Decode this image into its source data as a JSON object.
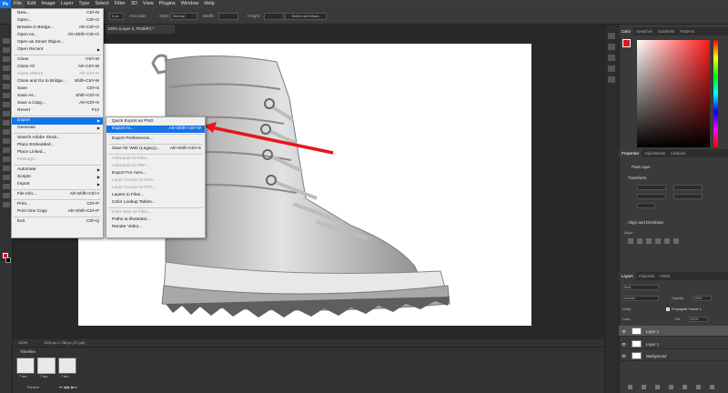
{
  "menubar": {
    "logo": "Ps",
    "items": [
      "File",
      "Edit",
      "Image",
      "Layer",
      "Type",
      "Select",
      "Filter",
      "3D",
      "View",
      "Plugins",
      "Window",
      "Help"
    ]
  },
  "options_bar": {
    "style_label": "Style:",
    "style_value": "Normal",
    "width_label": "Width:",
    "height_label": "Height:",
    "select_mask_button": "Select and Mask...",
    "feather_value": "0 px",
    "antialias_label": "Anti-alias"
  },
  "document": {
    "tab_title": "100% (Layer 2, RGB/8*) *",
    "zoom": "100%",
    "doc_info": "1200 px x 738 px (72 ppi)"
  },
  "file_menu": {
    "items": [
      {
        "label": "New...",
        "shortcut": "Ctrl+N",
        "disabled": false
      },
      {
        "label": "Open...",
        "shortcut": "Ctrl+O",
        "disabled": false
      },
      {
        "label": "Browse in Bridge...",
        "shortcut": "Alt+Ctrl+O",
        "disabled": false
      },
      {
        "label": "Open As...",
        "shortcut": "Alt+Shift+Ctrl+O",
        "disabled": false
      },
      {
        "label": "Open as Smart Object...",
        "shortcut": "",
        "disabled": false
      },
      {
        "label": "Open Recent",
        "shortcut": "",
        "disabled": false,
        "submenu": true
      },
      {
        "sep": true
      },
      {
        "label": "Close",
        "shortcut": "Ctrl+W",
        "disabled": false
      },
      {
        "label": "Close All",
        "shortcut": "Alt+Ctrl+W",
        "disabled": false
      },
      {
        "label": "Close Others",
        "shortcut": "Alt+Ctrl+P",
        "disabled": true
      },
      {
        "label": "Close and Go to Bridge...",
        "shortcut": "Shift+Ctrl+W",
        "disabled": false
      },
      {
        "label": "Save",
        "shortcut": "Ctrl+S",
        "disabled": false
      },
      {
        "label": "Save As...",
        "shortcut": "Shift+Ctrl+S",
        "disabled": false
      },
      {
        "label": "Save a Copy...",
        "shortcut": "Alt+Ctrl+S",
        "disabled": false
      },
      {
        "label": "Revert",
        "shortcut": "F12",
        "disabled": false
      },
      {
        "sep": true
      },
      {
        "label": "Export",
        "shortcut": "",
        "disabled": false,
        "submenu": true,
        "highlight": true
      },
      {
        "label": "Generate",
        "shortcut": "",
        "disabled": false,
        "submenu": true
      },
      {
        "sep": true
      },
      {
        "label": "Search Adobe Stock...",
        "shortcut": "",
        "disabled": false
      },
      {
        "label": "Place Embedded...",
        "shortcut": "",
        "disabled": false
      },
      {
        "label": "Place Linked...",
        "shortcut": "",
        "disabled": false
      },
      {
        "label": "Package...",
        "shortcut": "",
        "disabled": true
      },
      {
        "sep": true
      },
      {
        "label": "Automate",
        "shortcut": "",
        "disabled": false,
        "submenu": true
      },
      {
        "label": "Scripts",
        "shortcut": "",
        "disabled": false,
        "submenu": true
      },
      {
        "label": "Import",
        "shortcut": "",
        "disabled": false,
        "submenu": true
      },
      {
        "sep": true
      },
      {
        "label": "File Info...",
        "shortcut": "Alt+Shift+Ctrl+I",
        "disabled": false
      },
      {
        "sep": true
      },
      {
        "label": "Print...",
        "shortcut": "Ctrl+P",
        "disabled": false
      },
      {
        "label": "Print One Copy",
        "shortcut": "Alt+Shift+Ctrl+P",
        "disabled": false
      },
      {
        "sep": true
      },
      {
        "label": "Exit",
        "shortcut": "Ctrl+Q",
        "disabled": false
      }
    ]
  },
  "export_menu": {
    "items": [
      {
        "label": "Quick Export as PNG",
        "shortcut": "",
        "disabled": false
      },
      {
        "label": "Export As...",
        "shortcut": "Alt+Shift+Ctrl+W",
        "disabled": false,
        "highlight": true
      },
      {
        "sep": true
      },
      {
        "label": "Export Preferences...",
        "shortcut": "",
        "disabled": false
      },
      {
        "sep": true
      },
      {
        "label": "Save for Web (Legacy)...",
        "shortcut": "Alt+Shift+Ctrl+S",
        "disabled": false
      },
      {
        "sep": true
      },
      {
        "label": "Artboards to Files...",
        "shortcut": "",
        "disabled": true
      },
      {
        "label": "Artboards to PDF...",
        "shortcut": "",
        "disabled": true
      },
      {
        "label": "Export For Aero...",
        "shortcut": "",
        "disabled": false
      },
      {
        "label": "Layer Comps to Files...",
        "shortcut": "",
        "disabled": true
      },
      {
        "label": "Layer Comps to PDF...",
        "shortcut": "",
        "disabled": true
      },
      {
        "label": "Layers to Files...",
        "shortcut": "",
        "disabled": false
      },
      {
        "label": "Color Lookup Tables...",
        "shortcut": "",
        "disabled": false
      },
      {
        "sep": true
      },
      {
        "label": "Data Sets as Files...",
        "shortcut": "",
        "disabled": true
      },
      {
        "label": "Paths to Illustrator...",
        "shortcut": "",
        "disabled": false
      },
      {
        "label": "Render Video...",
        "shortcut": "",
        "disabled": false
      }
    ]
  },
  "right_panels": {
    "color_tabs": [
      "Color",
      "Swatches",
      "Gradients",
      "Patterns"
    ],
    "props_tabs": [
      "Properties",
      "Adjustments",
      "Libraries"
    ],
    "pixel_layer_label": "Pixel Layer",
    "transform_label": "Transform",
    "align_label": "Align and Distribute",
    "align_sub": "Align:",
    "layers_tabs": [
      "Layers",
      "Channels",
      "Paths"
    ],
    "kind_label": "Kind",
    "blend_mode": "Normal",
    "opacity_label": "Opacity:",
    "opacity_value": "100%",
    "unify_label": "Unify:",
    "propagate_label": "Propagate Frame 1",
    "lock_label": "Lock:",
    "fill_label": "Fill:",
    "fill_value": "100%",
    "layers": [
      {
        "name": "Layer 2",
        "selected": true
      },
      {
        "name": "Layer 1",
        "selected": false
      },
      {
        "name": "Background",
        "selected": false
      }
    ]
  },
  "timeline": {
    "title": "Timeline",
    "frames": [
      {
        "label": "7 sec."
      },
      {
        "label": "7 sec."
      },
      {
        "label": "7 sec."
      }
    ],
    "loop_label": "Forever"
  },
  "colors": {
    "accent": "#1473e6",
    "arrow": "#e8151b"
  }
}
